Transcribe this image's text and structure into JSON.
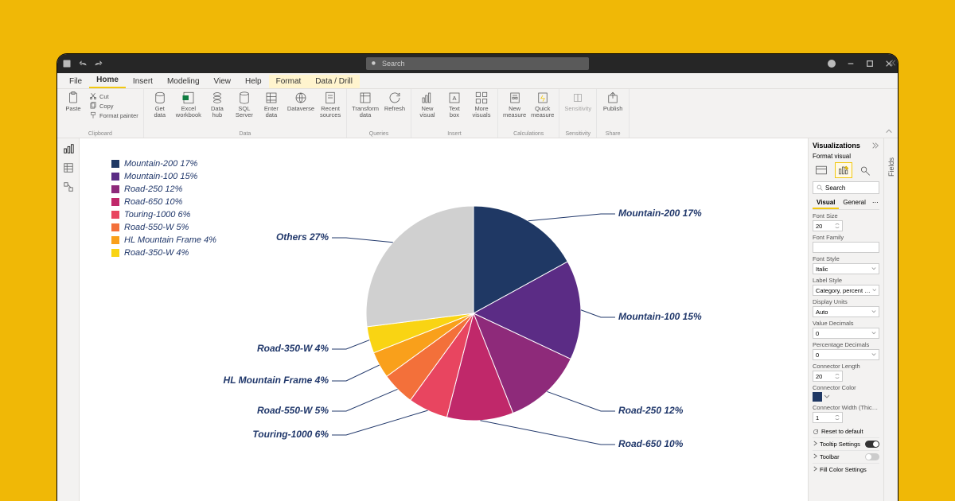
{
  "titlebar": {
    "search_placeholder": "Search"
  },
  "menu": {
    "file": "File",
    "home": "Home",
    "insert": "Insert",
    "modeling": "Modeling",
    "view": "View",
    "help": "Help",
    "format": "Format",
    "datadrill": "Data / Drill"
  },
  "ribbon": {
    "paste": "Paste",
    "cut": "Cut",
    "copy": "Copy",
    "format_painter": "Format painter",
    "clipboard_grp": "Clipboard",
    "get_data": "Get\ndata",
    "excel": "Excel\nworkbook",
    "data_hub": "Data\nhub",
    "sql": "SQL\nServer",
    "enter_data": "Enter\ndata",
    "dataverse": "Dataverse",
    "recent": "Recent\nsources",
    "data_grp": "Data",
    "transform": "Transform\ndata",
    "refresh": "Refresh",
    "queries_grp": "Queries",
    "new_visual": "New\nvisual",
    "text_box": "Text\nbox",
    "more_visuals": "More\nvisuals",
    "insert_grp": "Insert",
    "new_measure": "New\nmeasure",
    "quick_measure": "Quick\nmeasure",
    "calc_grp": "Calculations",
    "sensitivity": "Sensitivity",
    "sensitivity_grp": "Sensitivity",
    "publish": "Publish",
    "share_grp": "Share"
  },
  "chart_data": {
    "type": "pie",
    "series": [
      {
        "name": "Mountain-200",
        "value": 17,
        "label": "Mountain-200 17%",
        "color": "#1f3864"
      },
      {
        "name": "Mountain-100",
        "value": 15,
        "label": "Mountain-100 15%",
        "color": "#5b2c85"
      },
      {
        "name": "Road-250",
        "value": 12,
        "label": "Road-250 12%",
        "color": "#8e2a7a"
      },
      {
        "name": "Road-650",
        "value": 10,
        "label": "Road-650 10%",
        "color": "#c0286a"
      },
      {
        "name": "Touring-1000",
        "value": 6,
        "label": "Touring-1000 6%",
        "color": "#e84560"
      },
      {
        "name": "Road-550-W",
        "value": 5,
        "label": "Road-550-W 5%",
        "color": "#f3703a"
      },
      {
        "name": "HL Mountain Frame",
        "value": 4,
        "label": "HL Mountain Frame 4%",
        "color": "#f9a01b"
      },
      {
        "name": "Road-350-W",
        "value": 4,
        "label": "Road-350-W 4%",
        "color": "#f9d413"
      },
      {
        "name": "Others",
        "value": 27,
        "label": "Others 27%",
        "color": "#d0d0d0"
      }
    ]
  },
  "viz_panel": {
    "title": "Visualizations",
    "subtitle": "Format visual",
    "search": "Search",
    "tab_visual": "Visual",
    "tab_general": "General",
    "font_size_l": "Font Size",
    "font_size_v": "20",
    "font_family_l": "Font Family",
    "font_family_v": "",
    "font_style_l": "Font Style",
    "font_style_v": "Italic",
    "label_style_l": "Label Style",
    "label_style_v": "Category, percent of tot",
    "display_units_l": "Display Units",
    "display_units_v": "Auto",
    "value_dec_l": "Value Decimals",
    "value_dec_v": "0",
    "pct_dec_l": "Percentage Decimals",
    "pct_dec_v": "0",
    "conn_len_l": "Connector Length",
    "conn_len_v": "20",
    "conn_color_l": "Connector Color",
    "conn_width_l": "Connector Width (Thickn…",
    "conn_width_v": "1",
    "reset": "Reset to default",
    "tooltip": "Tooltip Settings",
    "toolbar": "Toolbar",
    "fillcolor": "Fill Color Settings"
  },
  "fields_tab": "Fields"
}
